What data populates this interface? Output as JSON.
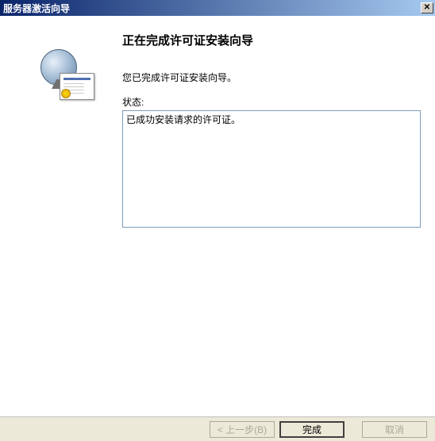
{
  "title": "服务器激活向导",
  "heading": "正在完成许可证安装向导",
  "intro": "您已完成许可证安装向导。",
  "status_label": "状态:",
  "status_text": "已成功安装请求的许可证。",
  "buttons": {
    "back": "< 上一步(B)",
    "finish": "完成",
    "cancel": "取消"
  }
}
